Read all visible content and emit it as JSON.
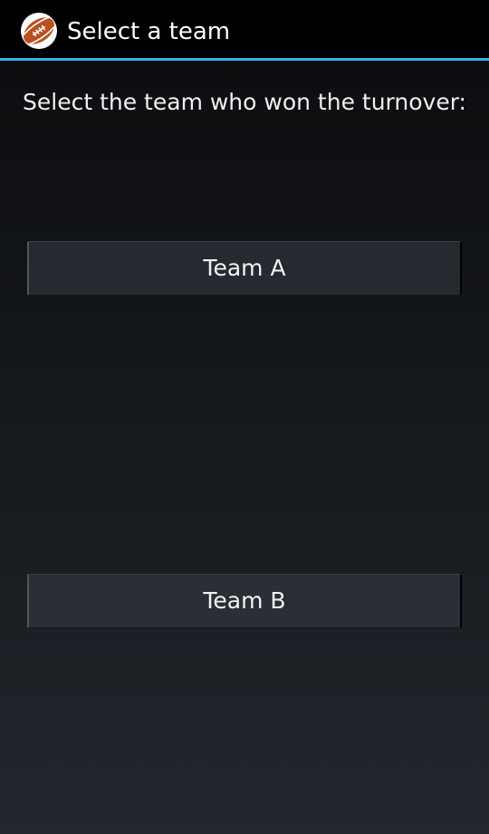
{
  "action_bar": {
    "title": "Select a team",
    "icon": "american-football-icon",
    "accent_color": "#33b5e5"
  },
  "prompt": "Select the team who won the turnover:",
  "buttons": {
    "team_a": "Team A",
    "team_b": "Team B"
  }
}
